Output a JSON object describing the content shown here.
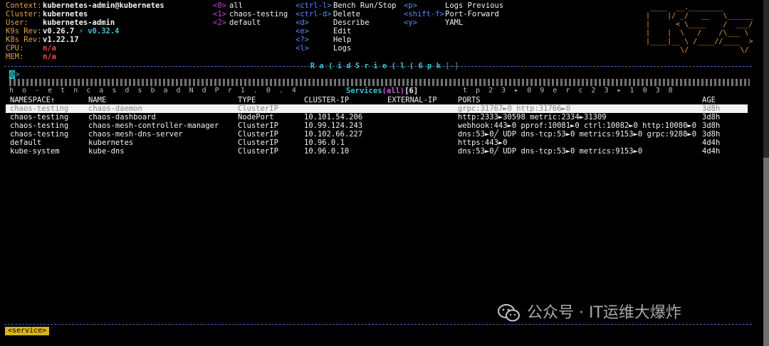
{
  "header": {
    "context_label": "Context:",
    "context_value": "kubernetes-admin@kubernetes",
    "cluster_label": "Cluster:",
    "cluster_value": "kubernetes",
    "user_label": "User:",
    "user_value": "kubernetes-admin",
    "k9s_rev_label": "K9s Rev:",
    "k9s_rev_value": "v0.26.7",
    "k9s_upgrade": "⚡ v0.32.4",
    "k8s_rev_label": "K8s Rev:",
    "k8s_rev_value": "v1.22.17",
    "cpu_label": "CPU:",
    "cpu_value": "n/a",
    "mem_label": "MEM:",
    "mem_value": "n/a"
  },
  "namespaces": [
    {
      "key": "<0>",
      "label": "all"
    },
    {
      "key": "<1>",
      "label": "chaos-testing"
    },
    {
      "key": "<2>",
      "label": "default"
    }
  ],
  "commands": [
    {
      "key": "<ctrl-l>",
      "label": "Bench Run/Stop"
    },
    {
      "key": "<ctrl-d>",
      "label": "Delete"
    },
    {
      "key": "<d>",
      "label": "Describe"
    },
    {
      "key": "<e>",
      "label": "Edit"
    },
    {
      "key": "<?>",
      "label": "Help"
    },
    {
      "key": "<l>",
      "label": "Logs"
    }
  ],
  "commands2": [
    {
      "key": "<p>",
      "label": "Logs Previous"
    },
    {
      "key": "<shift-f>",
      "label": "Port-Forward"
    },
    {
      "key": "<y>",
      "label": "YAML"
    }
  ],
  "logo_lines": [
    " ____  __.________       ",
    "|    |/ _/   __   \\______",
    "|      < \\____    /  ___/",
    "|    |  \\   /    /\\___ \\ ",
    "|____|__ \\ /____//____  >",
    "        \\/            \\/ "
  ],
  "panel": {
    "title_garbled": "R a ( i d S r i e ( l ( 6   p k",
    "title_bracket": "[-]",
    "crumb_icon": "@",
    "crumb_arrow": ">",
    "ghost_line": " h o - e t n     c a s d s b a d                     N d P r             1 . 0 . 4",
    "ghost_line_right": "t p 2 3 ▸ 0 9   e r c 2 3 ▸ 1 0                                   3 8",
    "overlay_title_prefix": "Services",
    "overlay_title_scope": "(all)",
    "overlay_title_count": "[6]"
  },
  "table": {
    "headers": {
      "namespace": "NAMESPACE↑",
      "name": "NAME",
      "type": "TYPE",
      "cluster_ip": "CLUSTER-IP",
      "external_ip": "EXTERNAL-IP",
      "ports": "PORTS",
      "age": "AGE"
    },
    "rows": [
      {
        "namespace": "chaos-testing",
        "name": "chaos-daemon",
        "type": "ClusterIP",
        "cluster_ip": "",
        "external_ip": "",
        "ports": "grpc:31767►0 http:31766►0",
        "age": "3d8h"
      },
      {
        "namespace": "chaos-testing",
        "name": "chaos-dashboard",
        "type": "NodePort",
        "cluster_ip": "10.101.54.206",
        "external_ip": "",
        "ports": "http:2333►30598 metric:2334►31309",
        "age": "3d8h"
      },
      {
        "namespace": "chaos-testing",
        "name": "chaos-mesh-controller-manager",
        "type": "ClusterIP",
        "cluster_ip": "10.99.124.243",
        "external_ip": "",
        "ports": "webhook:443►0 pprof:10081►0 ctrl:10082►0 http:10080►0",
        "age": "3d8h"
      },
      {
        "namespace": "chaos-testing",
        "name": "chaos-mesh-dns-server",
        "type": "ClusterIP",
        "cluster_ip": "10.102.66.227",
        "external_ip": "",
        "ports": "dns:53►0╱ UDP dns-tcp:53►0 metrics:9153►0 grpc:9288►0",
        "age": "3d8h"
      },
      {
        "namespace": "default",
        "name": "kubernetes",
        "type": "ClusterIP",
        "cluster_ip": "10.96.0.1",
        "external_ip": "",
        "ports": "https:443►0",
        "age": "4d4h"
      },
      {
        "namespace": "kube-system",
        "name": "kube-dns",
        "type": "ClusterIP",
        "cluster_ip": "10.96.0.10",
        "external_ip": "",
        "ports": "dns:53►0╱ UDP dns-tcp:53►0 metrics:9153►0",
        "age": "4d4h"
      }
    ]
  },
  "watermark": "公众号 · IT运维大爆炸",
  "footer_crumb": "<service>"
}
